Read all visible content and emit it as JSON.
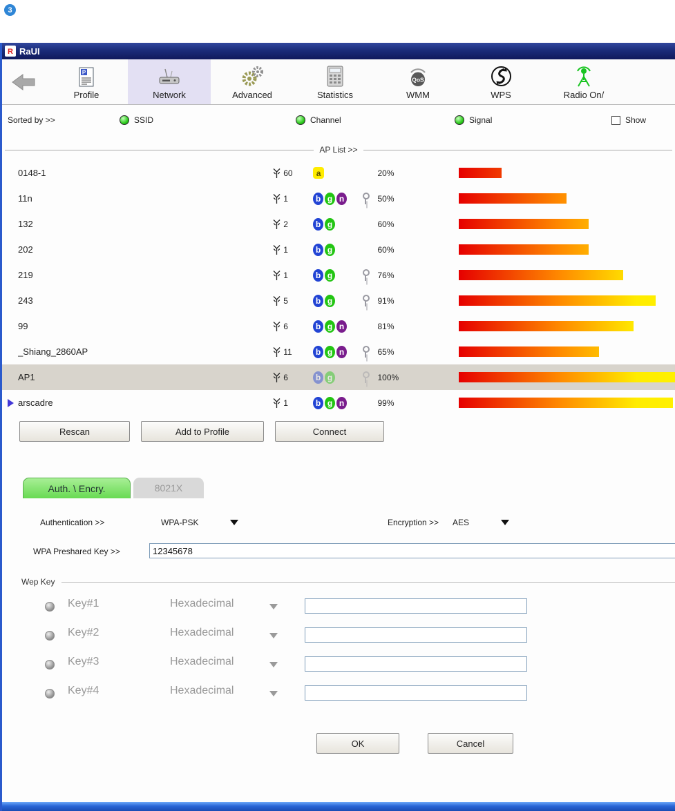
{
  "annotation": {
    "number": "3"
  },
  "window": {
    "title": "RaUI"
  },
  "toolbar": {
    "items": [
      {
        "label": "Profile"
      },
      {
        "label": "Network",
        "active": true
      },
      {
        "label": "Advanced"
      },
      {
        "label": "Statistics"
      },
      {
        "label": "WMM"
      },
      {
        "label": "WPS"
      },
      {
        "label": "Radio On/"
      }
    ]
  },
  "sort_bar": {
    "label": "Sorted by >>",
    "options": [
      "SSID",
      "Channel",
      "Signal"
    ],
    "show_label": "Show"
  },
  "ap_list": {
    "header": "AP List >>",
    "rows": [
      {
        "ssid": "0148-1",
        "channel": "60",
        "modes": [
          "a"
        ],
        "locked": false,
        "signal": "20%",
        "pct": 20
      },
      {
        "ssid": "11n",
        "channel": "1",
        "modes": [
          "b",
          "g",
          "n"
        ],
        "locked": true,
        "signal": "50%",
        "pct": 50
      },
      {
        "ssid": "132",
        "channel": "2",
        "modes": [
          "b",
          "g"
        ],
        "locked": false,
        "signal": "60%",
        "pct": 60
      },
      {
        "ssid": "202",
        "channel": "1",
        "modes": [
          "b",
          "g"
        ],
        "locked": false,
        "signal": "60%",
        "pct": 60
      },
      {
        "ssid": "219",
        "channel": "1",
        "modes": [
          "b",
          "g"
        ],
        "locked": true,
        "signal": "76%",
        "pct": 76
      },
      {
        "ssid": "243",
        "channel": "5",
        "modes": [
          "b",
          "g"
        ],
        "locked": true,
        "signal": "91%",
        "pct": 91
      },
      {
        "ssid": "99",
        "channel": "6",
        "modes": [
          "b",
          "g",
          "n"
        ],
        "locked": false,
        "signal": "81%",
        "pct": 81
      },
      {
        "ssid": "_Shiang_2860AP",
        "channel": "11",
        "modes": [
          "b",
          "g",
          "n"
        ],
        "locked": true,
        "signal": "65%",
        "pct": 65
      },
      {
        "ssid": "AP1",
        "channel": "6",
        "modes": [
          "b",
          "g"
        ],
        "locked": true,
        "signal": "100%",
        "pct": 100,
        "selected": true,
        "faded": true
      },
      {
        "ssid": "arscadre",
        "channel": "1",
        "modes": [
          "b",
          "g",
          "n"
        ],
        "locked": false,
        "signal": "99%",
        "pct": 99,
        "connected": true
      }
    ]
  },
  "actions": {
    "rescan": "Rescan",
    "add_to_profile": "Add to Profile",
    "connect": "Connect"
  },
  "auth_panel": {
    "tabs": [
      {
        "label": "Auth. \\ Encry.",
        "active": true
      },
      {
        "label": "8021X",
        "active": false
      }
    ],
    "authentication_label": "Authentication >>",
    "authentication_value": "WPA-PSK",
    "encryption_label": "Encryption >>",
    "encryption_value": "AES",
    "psk_label": "WPA Preshared Key >>",
    "psk_value": "12345678",
    "wep_group_label": "Wep Key",
    "wep_keys": [
      {
        "label": "Key#1",
        "format": "Hexadecimal",
        "value": ""
      },
      {
        "label": "Key#2",
        "format": "Hexadecimal",
        "value": ""
      },
      {
        "label": "Key#3",
        "format": "Hexadecimal",
        "value": ""
      },
      {
        "label": "Key#4",
        "format": "Hexadecimal",
        "value": ""
      }
    ],
    "ok": "OK",
    "cancel": "Cancel"
  }
}
